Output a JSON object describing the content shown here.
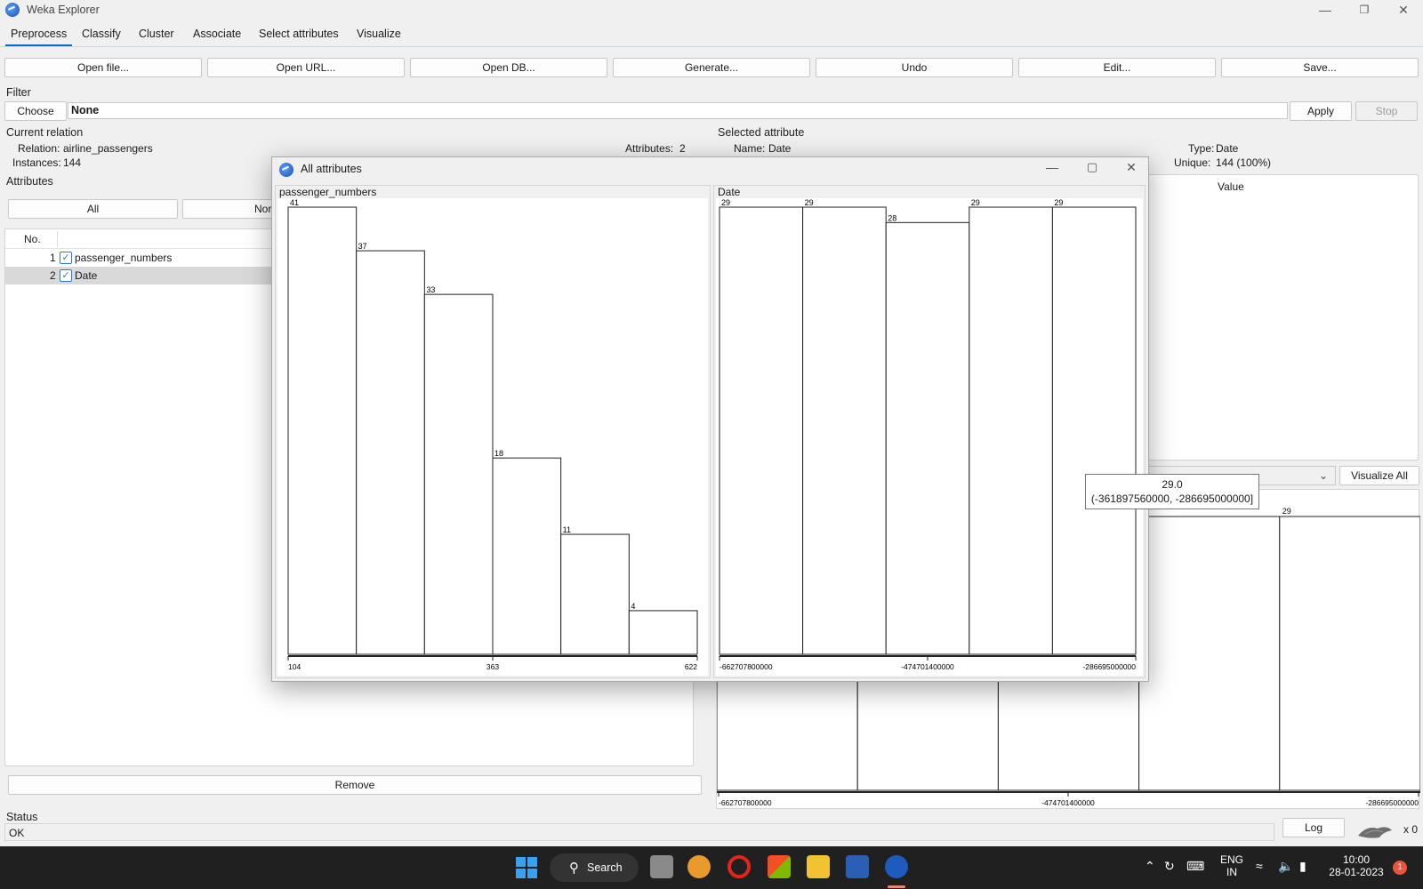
{
  "window": {
    "title": "Weka Explorer"
  },
  "tabs": [
    "Preprocess",
    "Classify",
    "Cluster",
    "Associate",
    "Select attributes",
    "Visualize"
  ],
  "toolbar": [
    "Open file...",
    "Open URL...",
    "Open DB...",
    "Generate...",
    "Undo",
    "Edit...",
    "Save..."
  ],
  "filter": {
    "title": "Filter",
    "choose": "Choose",
    "value": "None",
    "apply": "Apply",
    "stop": "Stop"
  },
  "relation": {
    "title": "Current relation",
    "relation_label": "Relation:",
    "relation_value": "airline_passengers",
    "instances_label": "Instances:",
    "instances_value": "144",
    "attributes_label": "Attributes:",
    "attributes_value": "2"
  },
  "attributes": {
    "title": "Attributes",
    "all": "All",
    "none": "Nor",
    "col_no": "No.",
    "rows": [
      {
        "no": "1",
        "name": "passenger_numbers",
        "checked": true
      },
      {
        "no": "2",
        "name": "Date",
        "checked": true
      }
    ],
    "remove": "Remove"
  },
  "selected": {
    "title": "Selected attribute",
    "name_label": "Name:",
    "name_value": "Date",
    "type_label": "Type:",
    "type_value": "Date",
    "unique_label": "Unique:",
    "unique_value": "144 (100%)",
    "value_col": "Value",
    "visualize_all": "Visualize All"
  },
  "status": {
    "title": "Status",
    "value": "OK",
    "log": "Log",
    "x_count": "x 0"
  },
  "dialog": {
    "title": "All attributes"
  },
  "chart_data": [
    {
      "type": "bar",
      "title": "passenger_numbers",
      "values": [
        41,
        37,
        33,
        18,
        11,
        4
      ],
      "tick_labels": [
        "104",
        "363",
        "622"
      ],
      "xlim": [
        104,
        622
      ]
    },
    {
      "type": "bar",
      "title": "Date",
      "values": [
        29,
        29,
        28,
        29,
        29
      ],
      "tick_labels": [
        "-662707800000",
        "-474701400000",
        "-286695000000"
      ],
      "xlim": [
        -662707800000,
        -286695000000
      ]
    },
    {
      "type": "bar",
      "title": "Date",
      "values": [
        29,
        29,
        28,
        29,
        29
      ],
      "visible_labels": [
        "29"
      ],
      "tick_labels": [
        "-662707800000",
        "-474701400000",
        "-286695000000"
      ],
      "xlim": [
        -662707800000,
        -286695000000
      ]
    }
  ],
  "tooltip": {
    "line1": "29.0",
    "line2": "(-361897560000, -286695000000]"
  },
  "taskbar": {
    "search": "Search",
    "lang1": "ENG",
    "lang2": "IN",
    "time": "10:00",
    "date": "28-01-2023",
    "notif": "1"
  }
}
